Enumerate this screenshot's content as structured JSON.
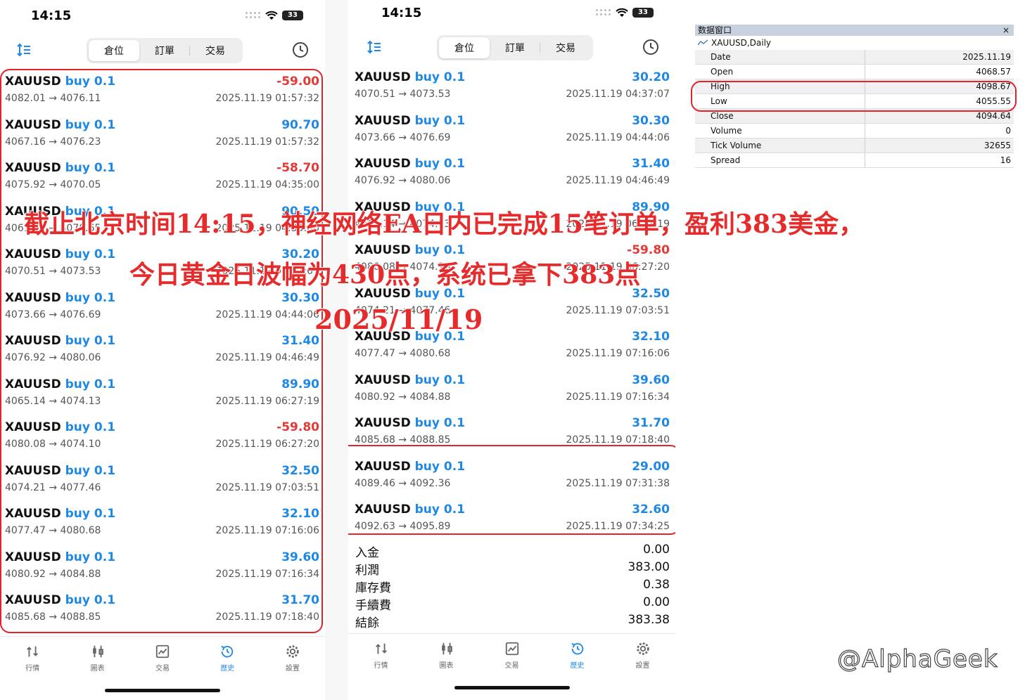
{
  "status": {
    "time": "14:15",
    "battery": "33"
  },
  "segments": [
    "倉位",
    "訂單",
    "交易"
  ],
  "left_trades": [
    {
      "symbol": "XAUUSD",
      "side": "buy 0.1",
      "pnl": "-59.00",
      "prices": "4082.01 → 4076.11",
      "time": "2025.11.19 01:57:32"
    },
    {
      "symbol": "XAUUSD",
      "side": "buy 0.1",
      "pnl": "90.70",
      "prices": "4067.16 → 4076.23",
      "time": "2025.11.19 01:57:32"
    },
    {
      "symbol": "XAUUSD",
      "side": "buy 0.1",
      "pnl": "-58.70",
      "prices": "4075.92 → 4070.05",
      "time": "2025.11.19 04:35:00"
    },
    {
      "symbol": "XAUUSD",
      "side": "buy 0.1",
      "pnl": "90.50",
      "prices": "4061.60 → 4070.65",
      "time": "2025.11.19 04:35:00"
    },
    {
      "symbol": "XAUUSD",
      "side": "buy 0.1",
      "pnl": "30.20",
      "prices": "4070.51 → 4073.53",
      "time": "2025.11.19 04:37:07"
    },
    {
      "symbol": "XAUUSD",
      "side": "buy 0.1",
      "pnl": "30.30",
      "prices": "4073.66 → 4076.69",
      "time": "2025.11.19 04:44:06"
    },
    {
      "symbol": "XAUUSD",
      "side": "buy 0.1",
      "pnl": "31.40",
      "prices": "4076.92 → 4080.06",
      "time": "2025.11.19 04:46:49"
    },
    {
      "symbol": "XAUUSD",
      "side": "buy 0.1",
      "pnl": "89.90",
      "prices": "4065.14 → 4074.13",
      "time": "2025.11.19 06:27:19"
    },
    {
      "symbol": "XAUUSD",
      "side": "buy 0.1",
      "pnl": "-59.80",
      "prices": "4080.08 → 4074.10",
      "time": "2025.11.19 06:27:20"
    },
    {
      "symbol": "XAUUSD",
      "side": "buy 0.1",
      "pnl": "32.50",
      "prices": "4074.21 → 4077.46",
      "time": "2025.11.19 07:03:51"
    },
    {
      "symbol": "XAUUSD",
      "side": "buy 0.1",
      "pnl": "32.10",
      "prices": "4077.47 → 4080.68",
      "time": "2025.11.19 07:16:06"
    },
    {
      "symbol": "XAUUSD",
      "side": "buy 0.1",
      "pnl": "39.60",
      "prices": "4080.92 → 4084.88",
      "time": "2025.11.19 07:16:34"
    },
    {
      "symbol": "XAUUSD",
      "side": "buy 0.1",
      "pnl": "31.70",
      "prices": "4085.68 → 4088.85",
      "time": "2025.11.19 07:18:40"
    }
  ],
  "right_trades": [
    {
      "symbol": "XAUUSD",
      "side": "buy 0.1",
      "pnl": "30.20",
      "prices": "4070.51 → 4073.53",
      "time": "2025.11.19 04:37:07"
    },
    {
      "symbol": "XAUUSD",
      "side": "buy 0.1",
      "pnl": "30.30",
      "prices": "4073.66 → 4076.69",
      "time": "2025.11.19 04:44:06"
    },
    {
      "symbol": "XAUUSD",
      "side": "buy 0.1",
      "pnl": "31.40",
      "prices": "4076.92 → 4080.06",
      "time": "2025.11.19 04:46:49"
    },
    {
      "symbol": "XAUUSD",
      "side": "buy 0.1",
      "pnl": "89.90",
      "prices": "4065.14 → 4074.13",
      "time": "2025.11.19 06:27:19"
    },
    {
      "symbol": "XAUUSD",
      "side": "buy 0.1",
      "pnl": "-59.80",
      "prices": "4080.08 → 4074.10",
      "time": "2025.11.19 06:27:20"
    },
    {
      "symbol": "XAUUSD",
      "side": "buy 0.1",
      "pnl": "32.50",
      "prices": "4074.21 → 4077.46",
      "time": "2025.11.19 07:03:51"
    },
    {
      "symbol": "XAUUSD",
      "side": "buy 0.1",
      "pnl": "32.10",
      "prices": "4077.47 → 4080.68",
      "time": "2025.11.19 07:16:06"
    },
    {
      "symbol": "XAUUSD",
      "side": "buy 0.1",
      "pnl": "39.60",
      "prices": "4080.92 → 4084.88",
      "time": "2025.11.19 07:16:34"
    },
    {
      "symbol": "XAUUSD",
      "side": "buy 0.1",
      "pnl": "31.70",
      "prices": "4085.68 → 4088.85",
      "time": "2025.11.19 07:18:40"
    },
    {
      "symbol": "XAUUSD",
      "side": "buy 0.1",
      "pnl": "29.00",
      "prices": "4089.46 → 4092.36",
      "time": "2025.11.19 07:31:38"
    },
    {
      "symbol": "XAUUSD",
      "side": "buy 0.1",
      "pnl": "32.60",
      "prices": "4092.63 → 4095.89",
      "time": "2025.11.19 07:34:25"
    }
  ],
  "summary": [
    {
      "label": "入金",
      "value": "0.00"
    },
    {
      "label": "利潤",
      "value": "383.00"
    },
    {
      "label": "庫存費",
      "value": "0.38"
    },
    {
      "label": "手續費",
      "value": "0.00"
    },
    {
      "label": "結餘",
      "value": "383.38"
    }
  ],
  "tabs": [
    {
      "label": "行情",
      "icon": "quotes-icon"
    },
    {
      "label": "圖表",
      "icon": "chart-icon"
    },
    {
      "label": "交易",
      "icon": "trade-icon"
    },
    {
      "label": "歷史",
      "icon": "history-icon"
    },
    {
      "label": "設置",
      "icon": "settings-icon"
    }
  ],
  "data_window": {
    "title": "数据窗口",
    "close": "×",
    "symbol": "XAUUSD,Daily",
    "rows": [
      {
        "key": "Date",
        "value": "2025.11.19"
      },
      {
        "key": "Open",
        "value": "4068.57"
      },
      {
        "key": "High",
        "value": "4098.67"
      },
      {
        "key": "Low",
        "value": "4055.55"
      },
      {
        "key": "Close",
        "value": "4094.64"
      },
      {
        "key": "Volume",
        "value": "0"
      },
      {
        "key": "Tick Volume",
        "value": "32655"
      },
      {
        "key": "Spread",
        "value": "16"
      }
    ]
  },
  "annotation": {
    "line1": "截止北京时间14:15，神经网络EA日内已完成15笔订单，盈利383美金，",
    "line2": "今日黄金日波幅为430点，系统已拿下383点",
    "line3": "2025/11/19"
  },
  "watermark": "@AlphaGeek",
  "colors": {
    "accent": "#1e88e5",
    "loss": "#e53935",
    "highlight": "#e32229"
  }
}
